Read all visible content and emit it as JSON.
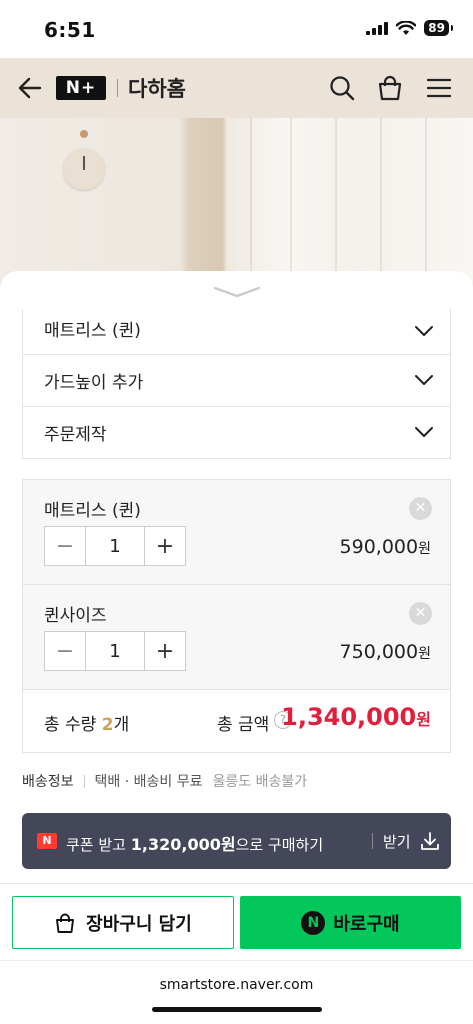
{
  "status_bar": {
    "time": "6:51",
    "battery": "89"
  },
  "header": {
    "logo": "N+",
    "store_name": "다하홈"
  },
  "options": [
    {
      "label": "매트리스 (퀸)"
    },
    {
      "label": "가드높이 추가"
    },
    {
      "label": "주문제작"
    }
  ],
  "selected_items": [
    {
      "name": "매트리스 (퀸)",
      "quantity": "1",
      "price": "590,000",
      "unit": "원"
    },
    {
      "name": "퀸사이즈",
      "quantity": "1",
      "price": "750,000",
      "unit": "원"
    }
  ],
  "summary": {
    "total_qty_label": "총 수량",
    "total_qty": "2",
    "total_qty_unit": "개",
    "total_amount_label": "총 금액",
    "help": "?",
    "total_amount": "1,340,000",
    "total_amount_unit": "원"
  },
  "shipping": {
    "label": "배송정보",
    "value": "택배 · 배송비 무료",
    "note": "울릉도 배송불가"
  },
  "coupon": {
    "badge": "N",
    "text_prefix": "쿠폰 받고 ",
    "amount": "1,320,000원",
    "text_suffix": "으로 구매하기",
    "action": "받기"
  },
  "actions": {
    "cart_label": "장바구니 담기",
    "buy_label": "바로구매",
    "buy_badge": "N"
  },
  "browser": {
    "url": "smartstore.naver.com"
  },
  "colors": {
    "accent": "#03c75a",
    "price": "#e01f3d",
    "coupon_bg": "#444659",
    "header_bg": "#ece3d8"
  }
}
